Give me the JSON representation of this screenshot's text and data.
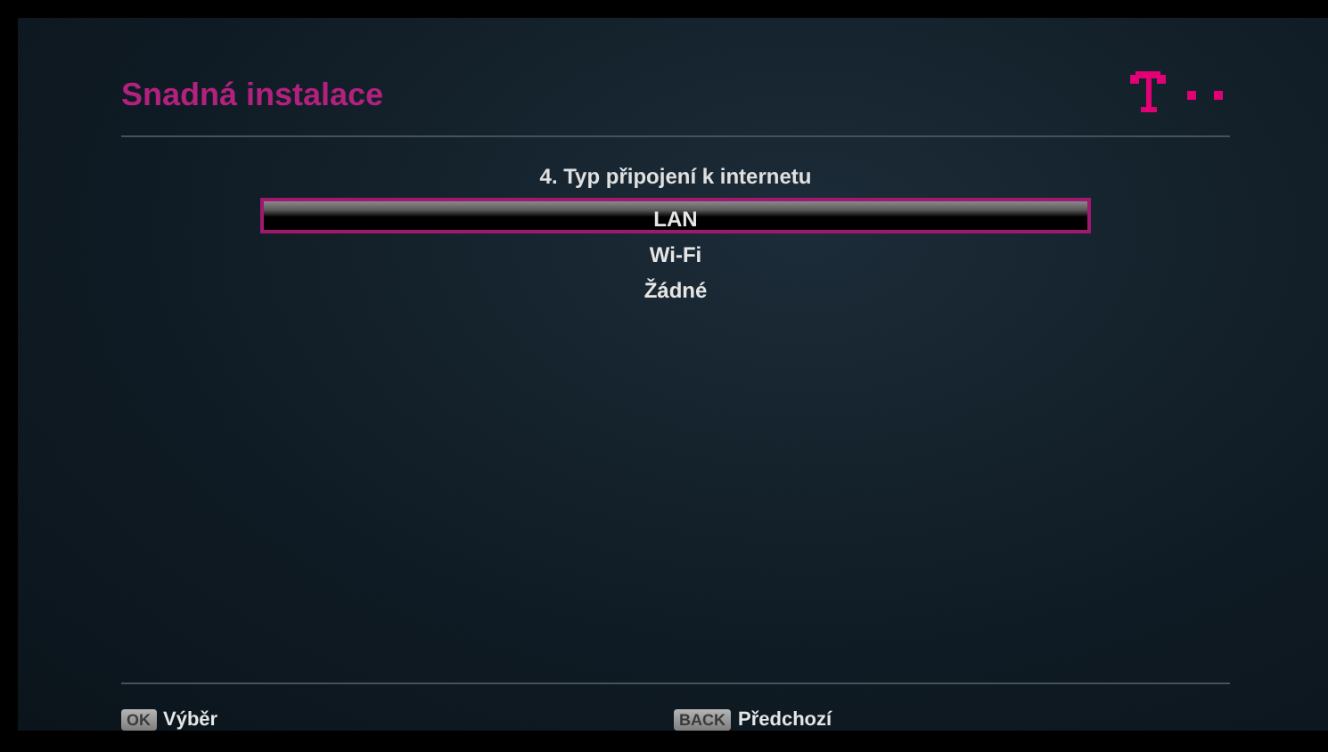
{
  "header": {
    "title": "Snadná instalace"
  },
  "step": {
    "title": "4. Typ připojení k internetu"
  },
  "options": [
    {
      "label": "LAN",
      "selected": true
    },
    {
      "label": "Wi-Fi",
      "selected": false
    },
    {
      "label": "Žádné",
      "selected": false
    }
  ],
  "footer": [
    {
      "key": "OK",
      "label": "Výběr"
    },
    {
      "key": "BACK",
      "label": "Předchozí"
    }
  ]
}
